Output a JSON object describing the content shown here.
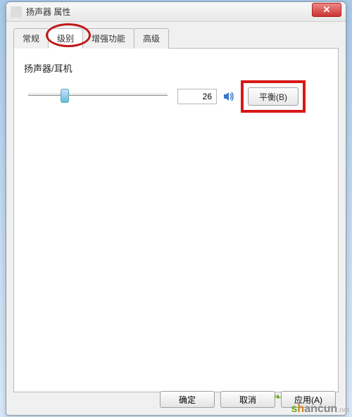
{
  "window": {
    "title": "扬声器 属性"
  },
  "tabs": {
    "items": [
      {
        "label": "常规"
      },
      {
        "label": "级别"
      },
      {
        "label": "增强功能"
      },
      {
        "label": "高级"
      }
    ],
    "active_index": 1
  },
  "volume": {
    "label": "扬声器/耳机",
    "value": "26",
    "balance_label": "平衡(B)",
    "speaker_icon": "speaker-icon"
  },
  "footer": {
    "ok": "确定",
    "cancel": "取消",
    "apply": "应用(A)"
  },
  "watermark": {
    "text": "shancun",
    "domain": ".net"
  }
}
